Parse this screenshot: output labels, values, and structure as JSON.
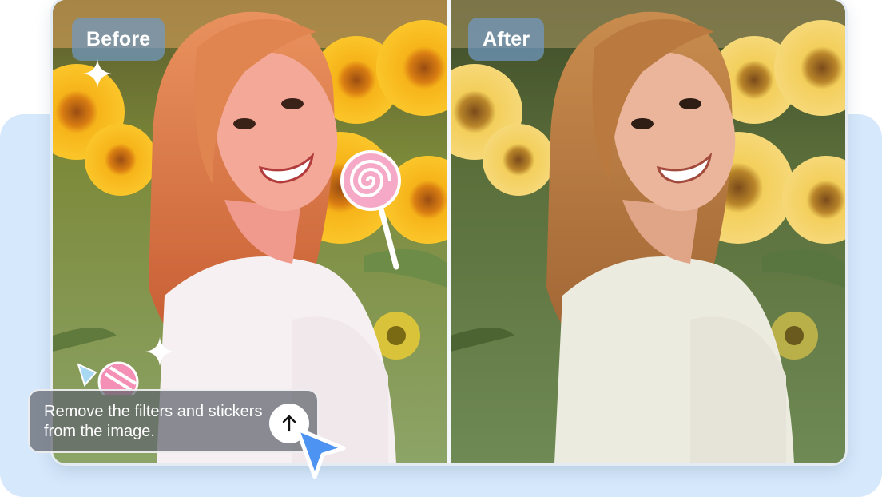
{
  "comparison": {
    "before_label": "Before",
    "after_label": "After"
  },
  "stickers": {
    "lollipop": "lollipop-sticker",
    "candy": "candy-sticker",
    "sparkles": [
      "sparkle-icon",
      "sparkle-icon"
    ]
  },
  "prompt": {
    "text": "Remove the filters and stickers from the image.",
    "submit_icon": "arrow-up-icon"
  },
  "cursor": "pointer-cursor-icon",
  "colors": {
    "panel_background": "#d6e8fb",
    "badge_background": "#7098c4",
    "cursor_blue": "#4d94f2",
    "prompt_background": "#5f646c"
  }
}
